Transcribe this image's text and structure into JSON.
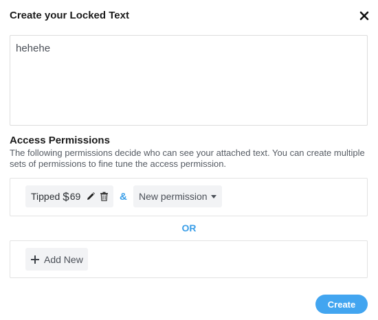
{
  "dialog": {
    "title": "Create your Locked Text",
    "close_icon": "close-icon"
  },
  "text_input": {
    "value": "hehehe"
  },
  "permissions": {
    "heading": "Access Permissions",
    "description": "The following permissions decide who can see your attached text. You can create multiple sets of permissions to fine tune the access permission.",
    "sets": [
      {
        "chips": [
          {
            "label": "Tipped",
            "currency": "$",
            "amount": "69",
            "edit_icon": "pencil-icon",
            "delete_icon": "trash-icon"
          }
        ],
        "joiner": "&",
        "new_permission_label": "New permission",
        "dropdown_icon": "caret-down-icon"
      }
    ],
    "or_label": "OR",
    "add_new_label": "Add New",
    "add_icon": "plus-icon"
  },
  "actions": {
    "create_label": "Create"
  },
  "colors": {
    "accent": "#42a5f0",
    "accent_text": "#3a9ee8",
    "chip_bg": "#f2f3f5",
    "border": "#e2e2e2"
  }
}
